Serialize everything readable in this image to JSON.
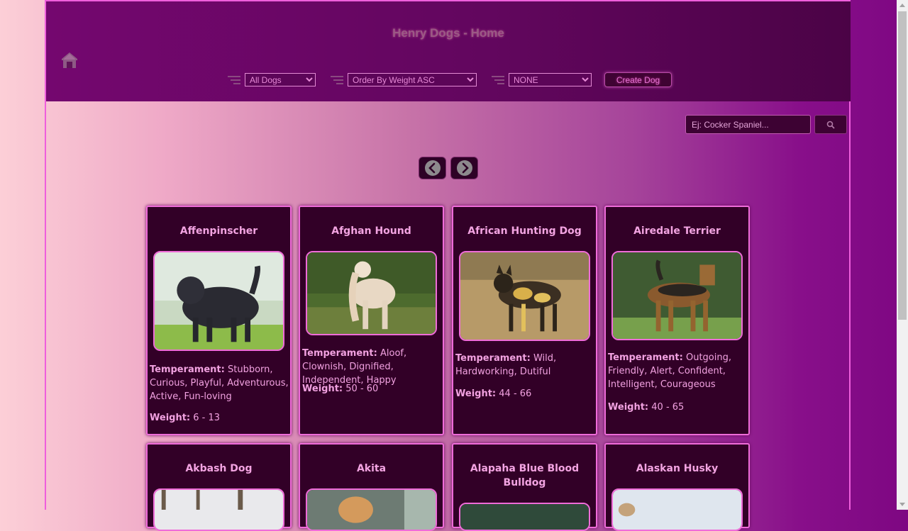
{
  "header": {
    "title": "Henry Dogs - Home",
    "filters": [
      {
        "selected": "All Dogs"
      },
      {
        "selected": "Order By Weight ASC"
      },
      {
        "selected": "NONE"
      }
    ],
    "create_label": "Create Dog"
  },
  "search": {
    "placeholder": "Ej: Cocker Spaniel..."
  },
  "pager": {
    "prev_icon": "chevron-left-icon",
    "next_icon": "chevron-right-icon"
  },
  "labels": {
    "temperament": "Temperament:",
    "weight": "Weight:"
  },
  "cards": [
    {
      "name": "Affenpinscher",
      "temperament": "Stubborn, Curious, Playful, Adventurous, Active, Fun-loving",
      "weight": "6 - 13"
    },
    {
      "name": "Afghan Hound",
      "temperament": "Aloof, Clownish, Dignified, Independent, Happy",
      "weight": "50 - 60"
    },
    {
      "name": "African Hunting Dog",
      "temperament": "Wild, Hardworking, Dutiful",
      "weight": "44 - 66"
    },
    {
      "name": "Airedale Terrier",
      "temperament": "Outgoing, Friendly, Alert, Confident, Intelligent, Courageous",
      "weight": "40 - 65"
    },
    {
      "name": "Akbash Dog"
    },
    {
      "name": "Akita"
    },
    {
      "name": "Alapaha Blue Blood Bulldog"
    },
    {
      "name": "Alaskan Husky"
    }
  ],
  "colors": {
    "accent": "#ef6cd9",
    "card_bg": "#320027",
    "header_bg": "#62065e"
  }
}
